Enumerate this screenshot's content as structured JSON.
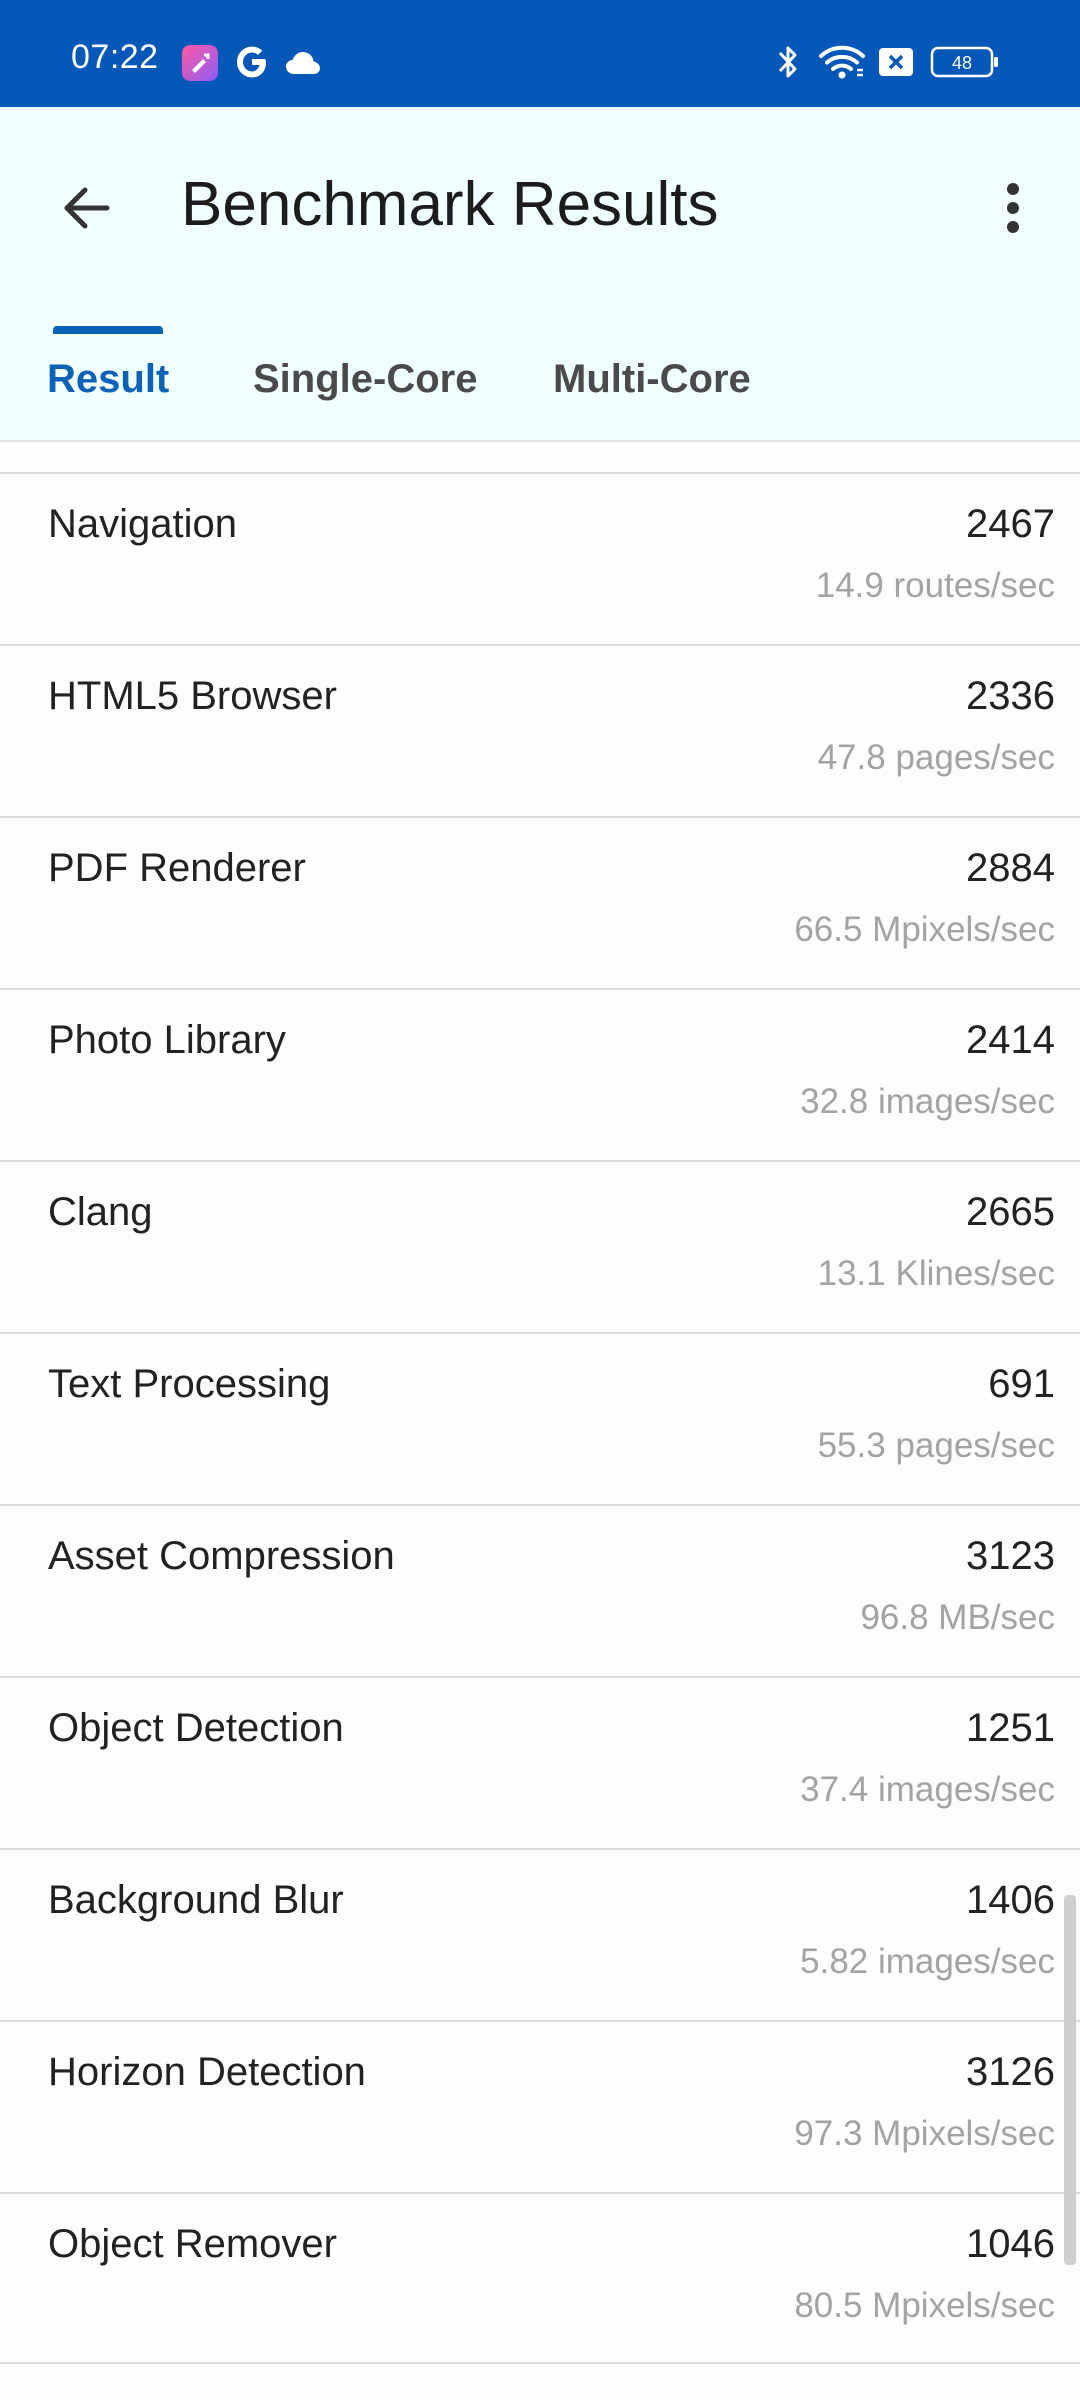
{
  "status_bar": {
    "time": "07:22",
    "battery": "48",
    "left_icons": [
      "app-notification-icon",
      "google-icon",
      "cloud-icon"
    ],
    "right_icons": [
      "bluetooth-icon",
      "wifi-icon",
      "sim-off-icon",
      "battery-icon"
    ]
  },
  "app_bar": {
    "title": "Benchmark Results",
    "back_icon": "arrow-back-icon",
    "more_icon": "more-vert-icon"
  },
  "tabs": [
    {
      "label": "Result",
      "active": true
    },
    {
      "label": "Single-Core",
      "active": false
    },
    {
      "label": "Multi-Core",
      "active": false
    }
  ],
  "colors": {
    "status_bar": "#0557b8",
    "app_bar": "#f0ffff",
    "accent": "#0d62b8"
  },
  "results": [
    {
      "name": "Navigation",
      "score": "2467",
      "rate": "14.9 routes/sec"
    },
    {
      "name": "HTML5 Browser",
      "score": "2336",
      "rate": "47.8 pages/sec"
    },
    {
      "name": "PDF Renderer",
      "score": "2884",
      "rate": "66.5 Mpixels/sec"
    },
    {
      "name": "Photo Library",
      "score": "2414",
      "rate": "32.8 images/sec"
    },
    {
      "name": "Clang",
      "score": "2665",
      "rate": "13.1 Klines/sec"
    },
    {
      "name": "Text Processing",
      "score": "691",
      "rate": "55.3 pages/sec"
    },
    {
      "name": "Asset Compression",
      "score": "3123",
      "rate": "96.8 MB/sec"
    },
    {
      "name": "Object Detection",
      "score": "1251",
      "rate": "37.4 images/sec"
    },
    {
      "name": "Background Blur",
      "score": "1406",
      "rate": "5.82 images/sec"
    },
    {
      "name": "Horizon Detection",
      "score": "3126",
      "rate": "97.3 Mpixels/sec"
    },
    {
      "name": "Object Remover",
      "score": "1046",
      "rate": "80.5 Mpixels/sec"
    }
  ]
}
